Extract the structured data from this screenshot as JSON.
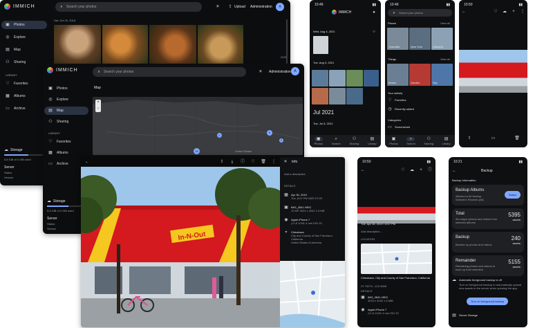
{
  "desktop_back": {
    "app_name": "IMMICH",
    "search_placeholder": "Search your photos",
    "upload_label": "Upload",
    "admin_label": "Administration",
    "avatar_initial": "A",
    "nav": [
      "Photos",
      "Explore",
      "Map",
      "Sharing",
      "Favorites",
      "Albums",
      "Archive"
    ],
    "library_heading": "LIBRARY",
    "date_header": "Sat, Oct 20, 2018",
    "storage_label": "Storage",
    "storage_used": "5.8 GiB of 4 GiB used",
    "server_label": "Server",
    "status_label": "Status",
    "version_label": "Version",
    "scroll_year": "2021"
  },
  "desktop_map": {
    "app_name": "IMMICH",
    "search_placeholder": "Search your photos",
    "admin_label": "Administration",
    "avatar_initial": "A",
    "nav": [
      "Photos",
      "Explore",
      "Map",
      "Sharing",
      "Favorites",
      "Albums",
      "Archive"
    ],
    "library_heading": "LIBRARY",
    "page_title": "Map",
    "storage_label": "Storage",
    "storage_used": "5.8 GiB of 4 GiB used",
    "server_label": "Server",
    "status_label": "Status",
    "version_label": "Version",
    "cluster_counts": [
      "2",
      "6",
      "2",
      "15"
    ],
    "zoom_in": "+",
    "zoom_out": "−",
    "map_label": "United States"
  },
  "viewer": {
    "info_title": "Info",
    "description_placeholder": "Add a description",
    "details_heading": "DETAILS",
    "date_line": "Apr 30, 2019",
    "time_line": "Tue, 8:07 PM GMT-07:00",
    "file_name": "IMG_2841.HEIC",
    "file_meta": "12 MP  3024 x 4032  1.6 MB",
    "camera": "Apple iPhone 7",
    "camera_meta": "ƒ/1.8  1/341  4 mm  ISO 20",
    "location_name": "Chinatown",
    "location_line1": "City and County of San Francisco,",
    "location_line2": "California",
    "location_line3": "United States of America",
    "sign_text": "In-N-Out"
  },
  "phone_timeline": {
    "time": "10:49",
    "app_name": "IMMICH",
    "date1": "Wed, Aug 4, 2021",
    "date2": "Tue, Aug 3, 2021",
    "month": "Jul 2021",
    "date3": "Tue, Jul 6, 2021",
    "tabs": [
      "Photos",
      "Search",
      "Sharing",
      "Library"
    ]
  },
  "phone_search": {
    "time": "10:49",
    "search_placeholder": "Search your photos",
    "places_heading": "Places",
    "view_all": "View all",
    "places": [
      "Yosemite",
      "New York",
      "Oakland"
    ],
    "things_heading": "Things",
    "things": [
      "Beach",
      "Garden",
      "Sky"
    ],
    "activity_heading": "Your activity",
    "favorites": "Favorites",
    "recently_added": "Recently added",
    "categories_heading": "Categories",
    "screenshots": "Screenshots",
    "tabs": [
      "Photos",
      "Search",
      "Sharing",
      "Library"
    ]
  },
  "phone_photo": {
    "time": "10:50"
  },
  "phone_detail": {
    "time": "10:50",
    "date": "Tue, Apr 30, 2019 • 8:07 PM",
    "add_description": "Add description...",
    "location_heading": "LOCATION",
    "location_text": "Chinatown, City and County of San Francisco, California",
    "coords": "37.79279, -122.4068",
    "details_heading": "DETAILS",
    "file_name": "IMG_2841.HEIC",
    "file_meta": "3024 x 4032  1.6 MiB",
    "camera": "Apple iPhone 7",
    "camera_meta": "ƒ/1.8  1/341  4 mm  ISO 20"
  },
  "phone_backup": {
    "time": "10:21",
    "title": "Backup",
    "info_heading": "Backup Information",
    "albums_title": "Backup Albums",
    "albums_sub": "Albums to be backup",
    "albums_selected": "Selected: Recents (All)",
    "select_btn": "Select",
    "total_title": "Total",
    "total_value": "5395",
    "total_unit": "assets",
    "total_sub": "All unique photos and videos from selected albums",
    "backup_title": "Backup",
    "backup_value": "240",
    "backup_unit": "assets",
    "backup_sub": "Backed up photos and videos",
    "remainder_title": "Remainder",
    "remainder_value": "5155",
    "remainder_unit": "assets",
    "remainder_sub": "Remaining photos and videos to back up from selection",
    "auto_title": "Automatic foreground backup is off",
    "auto_sub": "Turn on foreground backup to automatically upload new assets to the server when opening the app.",
    "turn_on_btn": "Turn on foreground backup",
    "storage_heading": "Server Storage"
  }
}
